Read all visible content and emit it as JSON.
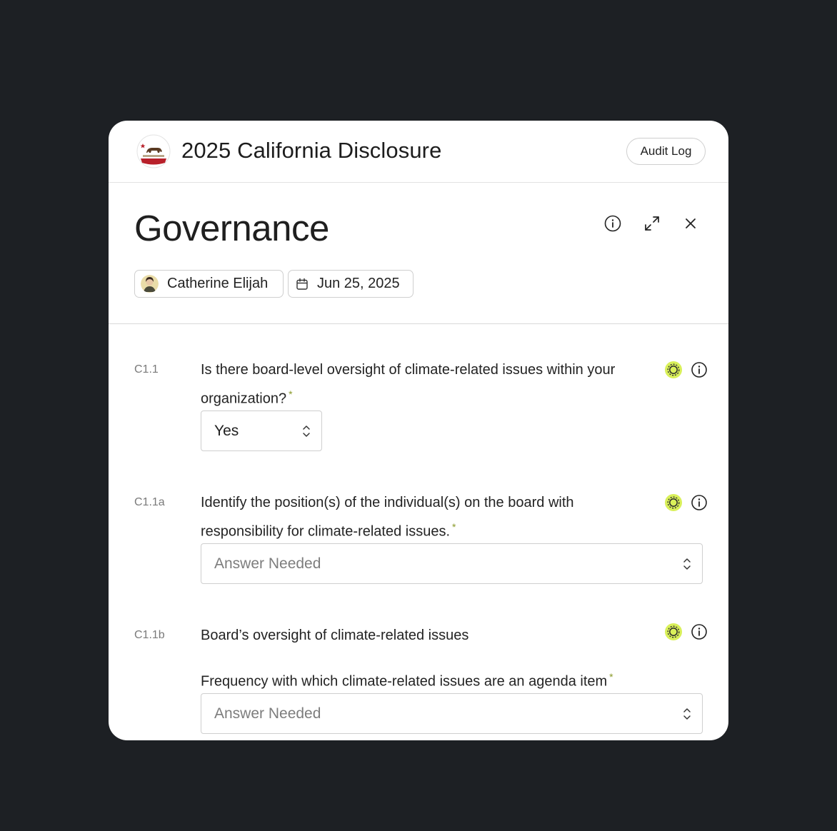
{
  "header": {
    "title": "2025 California Disclosure",
    "audit_log_label": "Audit Log"
  },
  "section": {
    "title": "Governance",
    "owner": "Catherine Elijah",
    "date": "Jun 25, 2025"
  },
  "questions": [
    {
      "code": "C1.1",
      "text": "Is there board-level oversight of climate-related issues within your organization?",
      "required_mark": "*",
      "answer": "Yes"
    },
    {
      "code": "C1.1a",
      "text": "Identify the position(s) of the individual(s) on the board with responsibility for climate-related issues.",
      "required_mark": "*",
      "placeholder": "Answer Needed"
    },
    {
      "code": "C1.1b",
      "text": "Board’s oversight of climate-related issues",
      "sub_text": "Frequency with which climate-related issues are an agenda item",
      "required_mark": "*",
      "placeholder": "Answer Needed"
    }
  ],
  "colors": {
    "ai_badge": "#d9f05a",
    "required": "#8a9a2a",
    "background": "#1d2024"
  },
  "icons": {
    "info": "info-icon",
    "expand": "expand-icon",
    "close": "close-icon",
    "calendar": "calendar-icon",
    "ai": "ai-assist-icon",
    "select": "chevron-updown-icon"
  }
}
